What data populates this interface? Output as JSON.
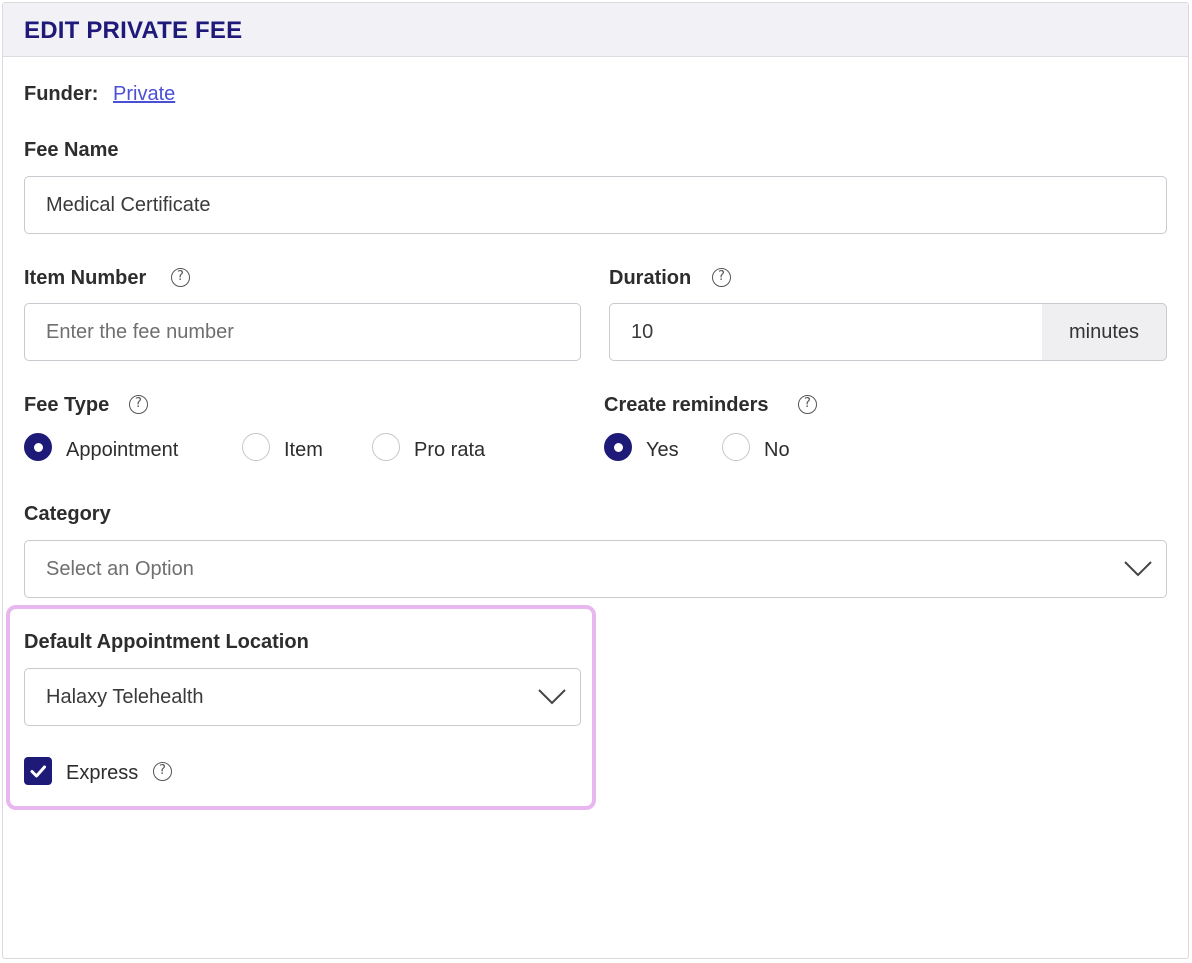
{
  "header": {
    "title": "EDIT PRIVATE FEE"
  },
  "funder": {
    "label": "Funder:",
    "value": "Private"
  },
  "fee_name": {
    "label": "Fee Name",
    "value": "Medical Certificate"
  },
  "item_number": {
    "label": "Item Number",
    "placeholder": "Enter the fee number"
  },
  "duration": {
    "label": "Duration",
    "value": "10",
    "unit": "minutes"
  },
  "fee_type": {
    "label": "Fee Type",
    "options": [
      "Appointment",
      "Item",
      "Pro rata"
    ],
    "selected": "Appointment"
  },
  "reminders": {
    "label": "Create reminders",
    "options": [
      "Yes",
      "No"
    ],
    "selected": "Yes"
  },
  "category": {
    "label": "Category",
    "placeholder": "Select an Option"
  },
  "location": {
    "label": "Default Appointment Location",
    "value": "Halaxy Telehealth"
  },
  "express": {
    "label": "Express",
    "checked": true
  },
  "colors": {
    "accent": "#1e1a78",
    "title": "#1f1a7a",
    "link": "#4a4fd6",
    "highlight": "#e8b7f0",
    "header_bg": "#f1f1f6"
  },
  "icons": [
    "help-circle-icon",
    "chevron-down-icon",
    "checkmark-icon"
  ]
}
